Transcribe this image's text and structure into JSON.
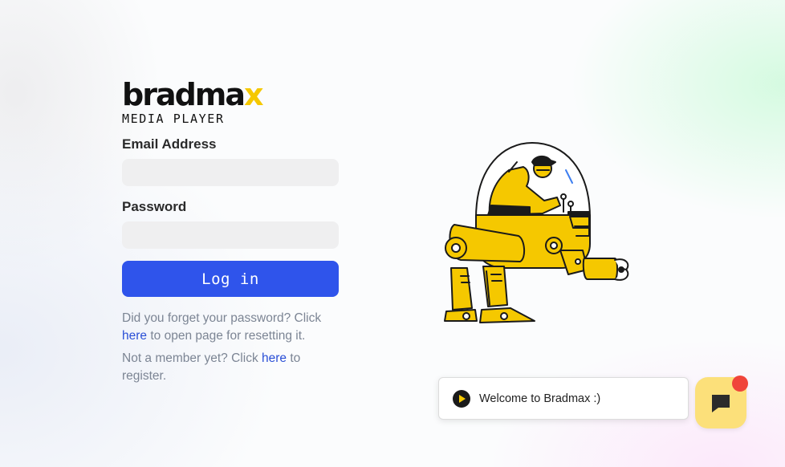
{
  "brand": {
    "wordmark_main": "bradma",
    "wordmark_x": "x",
    "subtitle": "MEDIA PLAYER",
    "accent_color": "#f5c800"
  },
  "form": {
    "email_label": "Email Address",
    "email_value": "",
    "password_label": "Password",
    "password_value": "",
    "login_label": "Log in",
    "button_color": "#2f54eb"
  },
  "help": {
    "forgot_prefix": "Did you forget your password? Click",
    "forgot_link": "here",
    "forgot_suffix": "to open page for resetting it.",
    "register_prefix": "Not a member yet? Click",
    "register_link": "here",
    "register_suffix": "to register."
  },
  "illustration": {
    "icon": "robot-mech-pilot-illustration"
  },
  "chat": {
    "welcome_text": "Welcome to Bradmax :)",
    "bubble_icon": "play-circle-icon",
    "launcher_icon": "chat-bubble-icon",
    "launcher_color": "#fce07a",
    "notification_color": "#f0443a"
  }
}
